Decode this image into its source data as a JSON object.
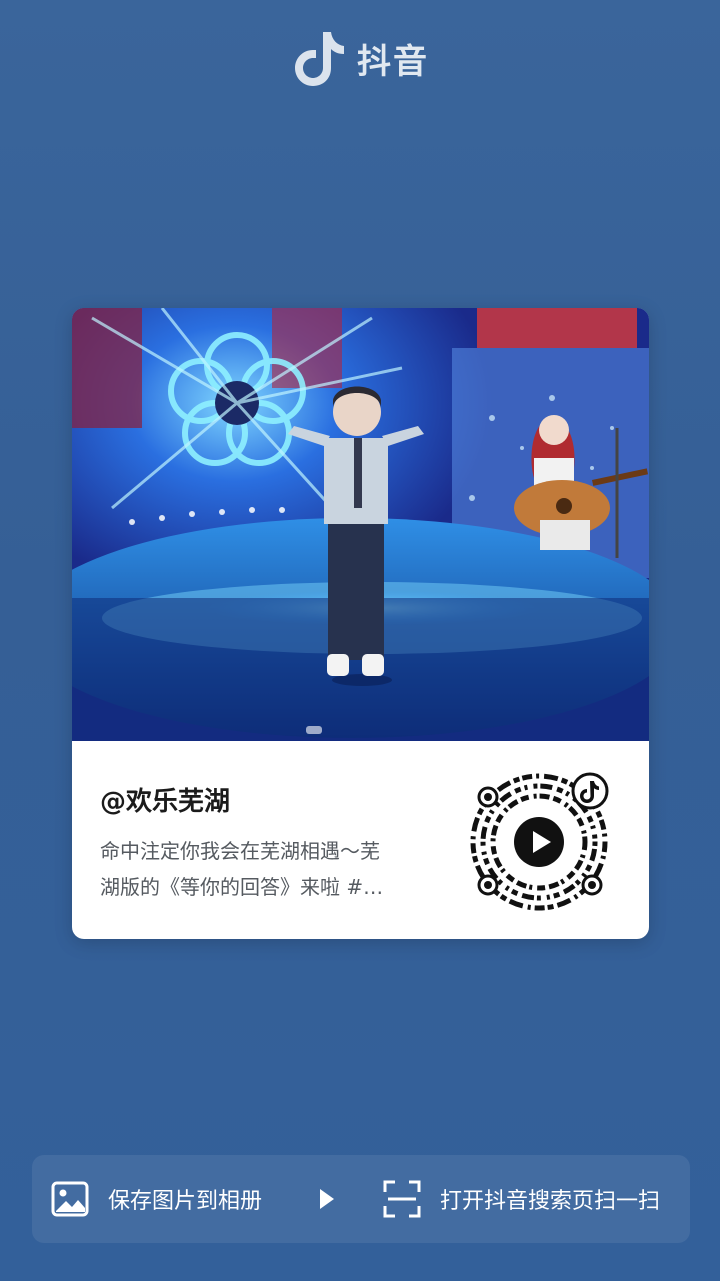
{
  "brand": {
    "name": "抖音"
  },
  "card": {
    "author": "@欢乐芜湖",
    "description_lines": [
      "命中注定你我会在芜湖相遇～芜",
      "湖版的《等你的回答》来啦 #…"
    ]
  },
  "actions": {
    "save_label": "保存图片到相册",
    "scan_label": "打开抖音搜索页扫一扫"
  },
  "colors": {
    "background": "#355f96",
    "card": "#ffffff",
    "text_dark": "#1b1b1b",
    "text_muted": "#555a60"
  },
  "icons": {
    "brand": "douyin-note-icon",
    "save": "image-icon",
    "arrow": "play-triangle-icon",
    "scan": "scan-icon",
    "qr_center": "play-icon",
    "qr_badge": "douyin-note-icon"
  }
}
